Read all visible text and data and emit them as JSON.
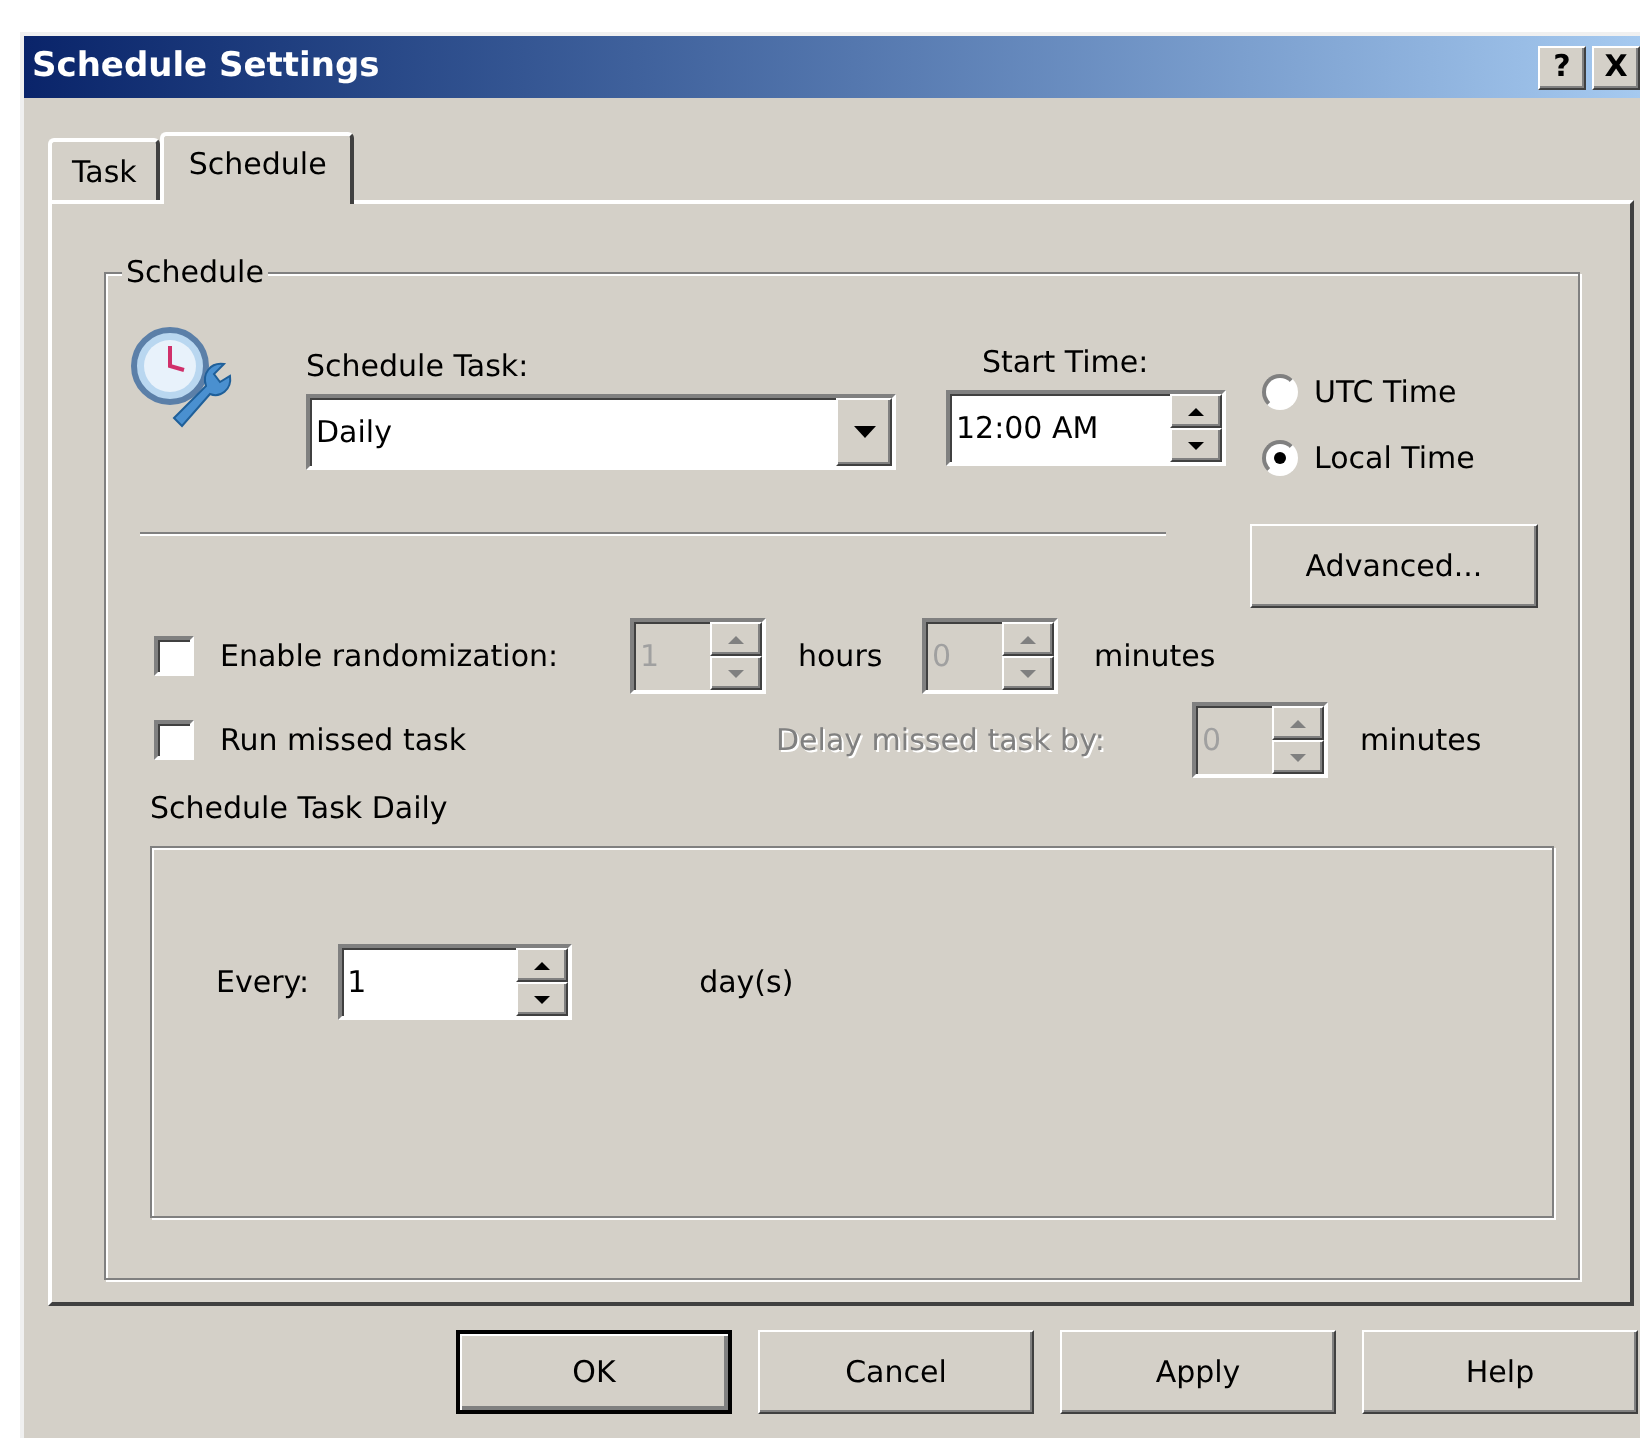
{
  "window": {
    "title": "Schedule Settings",
    "title_buttons": [
      "?",
      "X"
    ]
  },
  "tabs": [
    {
      "label": "Task",
      "selected": false
    },
    {
      "label": "Schedule",
      "selected": true
    }
  ],
  "group": {
    "title": "Schedule"
  },
  "schedule_task": {
    "label": "Schedule Task:",
    "value": "Daily"
  },
  "start_time": {
    "label": "Start Time:",
    "value": "12:00 AM"
  },
  "time_zone": [
    {
      "label": "UTC Time",
      "selected": false
    },
    {
      "label": "Local Time",
      "selected": true
    }
  ],
  "advanced_button": {
    "label": "Advanced..."
  },
  "randomization": {
    "label": "Enable randomization:",
    "checked": false,
    "hours": {
      "value": "1",
      "disabled": true
    },
    "hours_label": "hours",
    "minutes": {
      "value": "0",
      "disabled": true
    },
    "minutes_label": "minutes"
  },
  "run_missed": {
    "label": "Run missed task",
    "checked": false
  },
  "delay": {
    "label": "Delay missed task by:",
    "disabled": true,
    "value": "0",
    "unit": "minutes"
  },
  "daily": {
    "title": "Schedule Task Daily",
    "every_label": "Every:",
    "value": "1",
    "unit": "day(s)"
  },
  "buttons": [
    {
      "label": "OK",
      "default": true
    },
    {
      "label": "Cancel",
      "default": false
    },
    {
      "label": "Apply",
      "default": false
    },
    {
      "label": "Help",
      "default": false
    }
  ]
}
